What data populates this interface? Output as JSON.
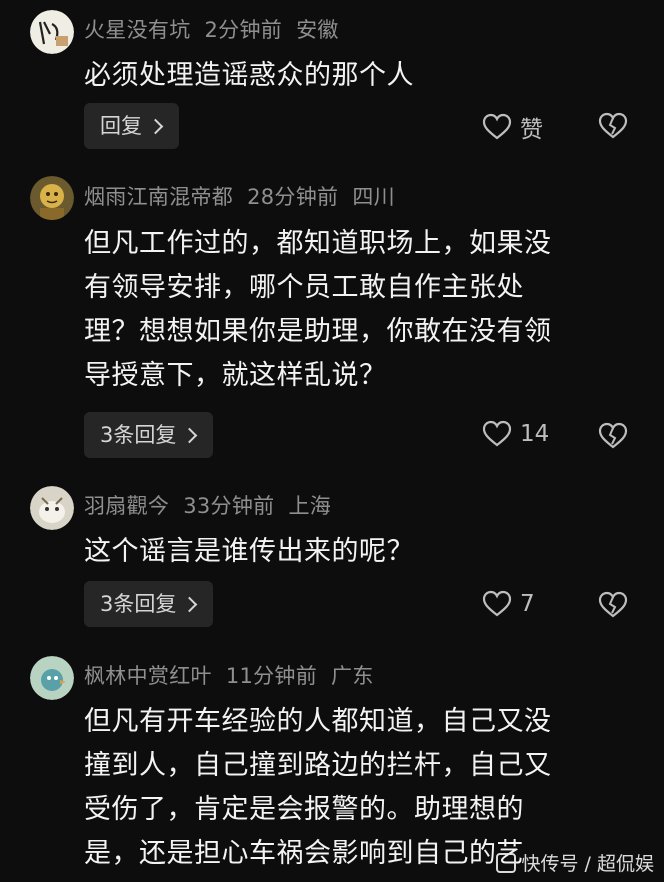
{
  "comments": [
    {
      "username": "火星没有坑",
      "time": "2分钟前",
      "location": "安徽",
      "lines": [
        "必须处理造谣惑众的那个人"
      ],
      "reply_label": "回复",
      "like_label": "赞"
    },
    {
      "username": "烟雨江南混帝都",
      "time": "28分钟前",
      "location": "四川",
      "lines": [
        "但凡工作过的，都知道职场上，如果没",
        "有领导安排，哪个员工敢自作主张处",
        "理？想想如果你是助理，你敢在没有领",
        "导授意下，就这样乱说？"
      ],
      "reply_label": "3条回复",
      "like_label": "14"
    },
    {
      "username": "羽扇觀今",
      "time": "33分钟前",
      "location": "上海",
      "lines": [
        "这个谣言是谁传出来的呢？"
      ],
      "reply_label": "3条回复",
      "like_label": "7"
    },
    {
      "username": "枫林中赏红叶",
      "time": "11分钟前",
      "location": "广东",
      "lines": [
        "但凡有开车经验的人都知道，自己又没",
        "撞到人，自己撞到路边的拦杆，自己又",
        "受伤了，肯定是会报警的。助理想的",
        "是，还是担心车祸会影响到自己的艺"
      ]
    }
  ],
  "watermark": "快传号 / 超侃娱",
  "icons": {
    "like": "heart-outline-icon",
    "dislike": "broken-heart-icon",
    "reply_chevron": "chevron-right-icon"
  },
  "colors": {
    "background": "#0d0d0d",
    "meta_text": "#8f8f8f",
    "body_text": "#f3f3f3",
    "reply_bg": "#262626"
  }
}
